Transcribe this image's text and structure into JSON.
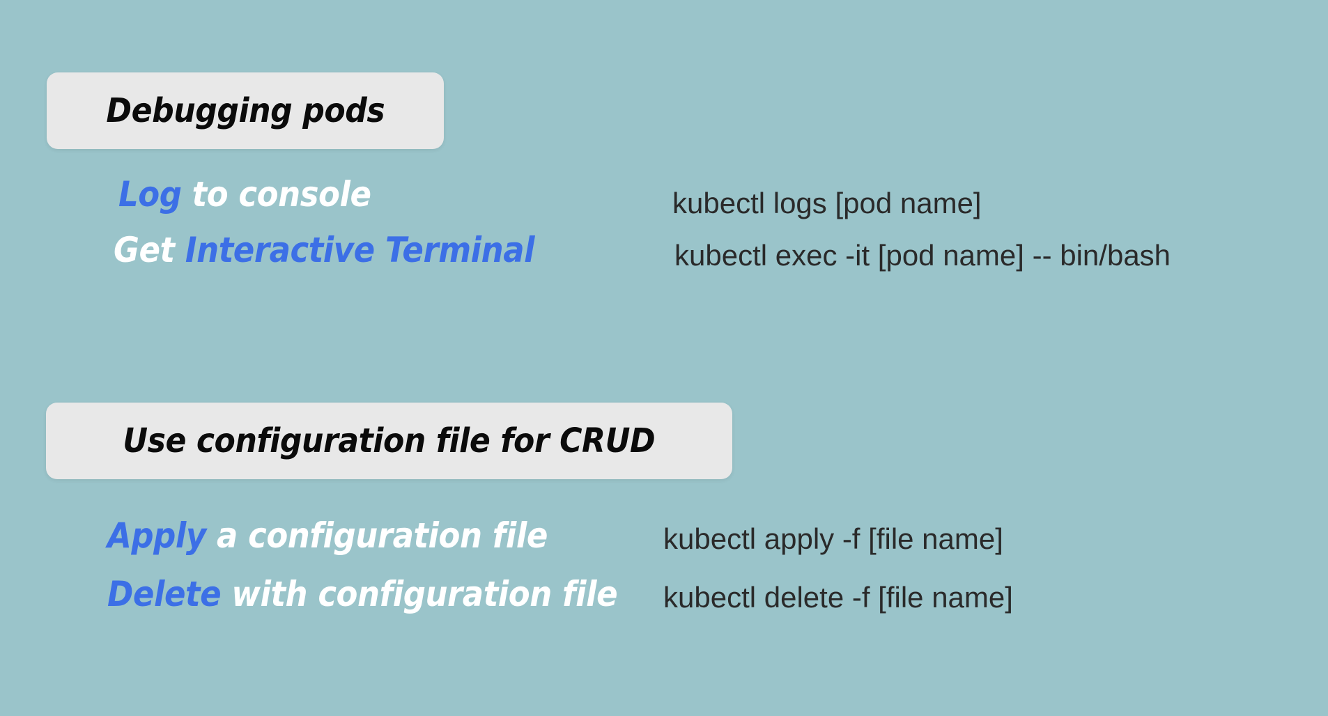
{
  "sections": [
    {
      "title": "Debugging pods",
      "items": [
        {
          "accent": "Log",
          "rest": " to console",
          "accent_first": true,
          "command": "kubectl logs [pod name]"
        },
        {
          "plain": "Get ",
          "accent": "Interactive Terminal",
          "accent_first": false,
          "command": "kubectl exec -it [pod name] -- bin/bash"
        }
      ]
    },
    {
      "title": "Use configuration file for CRUD",
      "items": [
        {
          "accent": "Apply",
          "rest": " a configuration file",
          "accent_first": true,
          "command": "kubectl apply -f [file name]"
        },
        {
          "accent": "Delete",
          "rest": " with configuration file",
          "accent_first": true,
          "command": "kubectl delete -f [file name]"
        }
      ]
    }
  ],
  "colors": {
    "background": "#9ac4ca",
    "header_box": "#e8e8e8",
    "accent": "#3c6fe6",
    "label_text": "#ffffff",
    "command_text": "#2a2a2a"
  }
}
